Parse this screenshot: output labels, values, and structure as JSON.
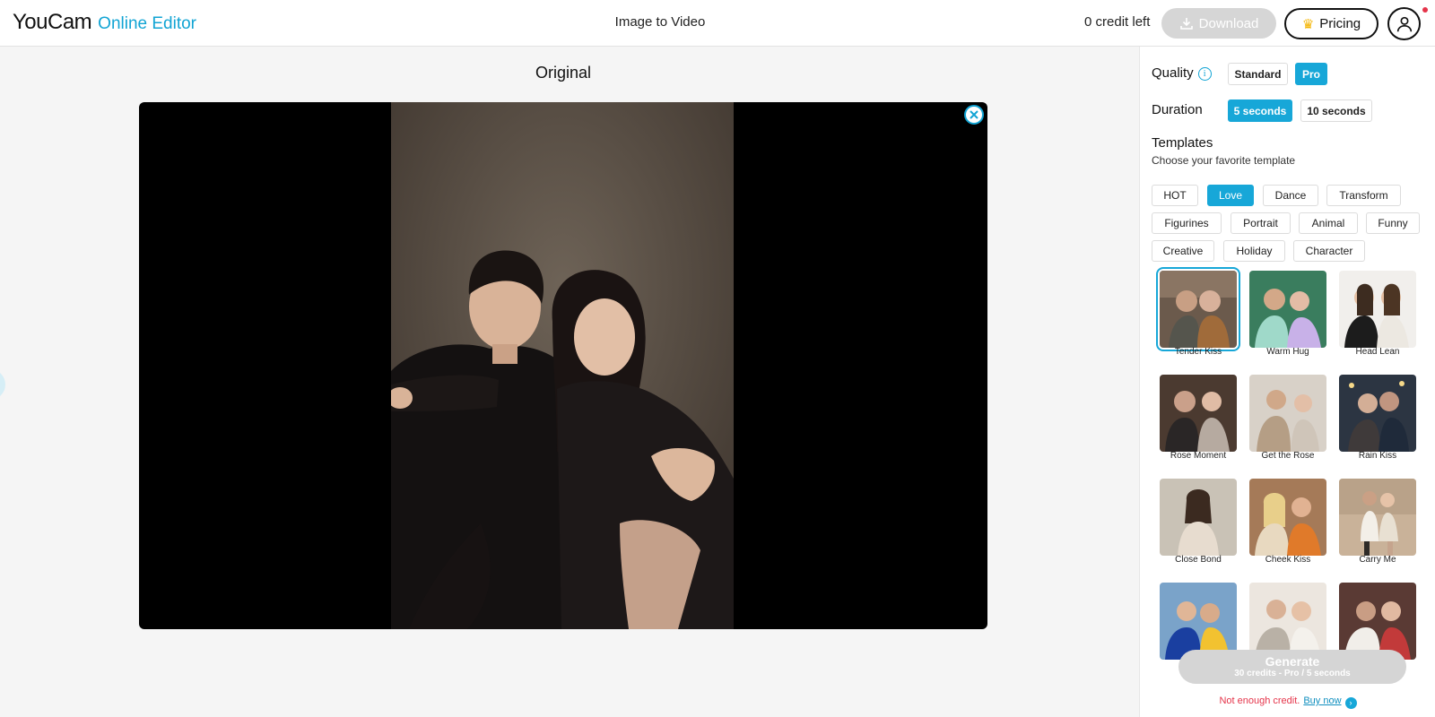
{
  "header": {
    "logo_main": "YouCam",
    "logo_sub": "Online Editor",
    "title": "Image to Video",
    "credits": "0 credit left",
    "download_label": "Download",
    "pricing_label": "Pricing"
  },
  "main": {
    "title": "Original"
  },
  "panel": {
    "quality": {
      "label": "Quality",
      "options": [
        "Standard",
        "Pro"
      ],
      "selected": "Pro"
    },
    "duration": {
      "label": "Duration",
      "options": [
        "5 seconds",
        "10 seconds"
      ],
      "selected": "5 seconds"
    },
    "templates": {
      "title": "Templates",
      "subtitle": "Choose your favorite template",
      "categories": [
        "HOT",
        "Love",
        "Dance",
        "Transform",
        "Figurines",
        "Portrait",
        "Animal",
        "Funny",
        "Creative",
        "Holiday",
        "Character"
      ],
      "selected_category": "Love",
      "items": [
        "Tender Kiss",
        "Warm Hug",
        "Head Lean",
        "Rose Moment",
        "Get the Rose",
        "Rain Kiss",
        "Close Bond",
        "Cheek Kiss",
        "Carry Me"
      ],
      "selected_item": "Tender Kiss"
    },
    "generate": {
      "label": "Generate",
      "sub": "30 credits - Pro / 5 seconds"
    },
    "warning": {
      "text": "Not enough credit.",
      "link": "Buy now"
    }
  },
  "colors": {
    "accent": "#17a7d8",
    "logo_accent": "#11a4d4",
    "warning": "#e5344a",
    "disabled": "#d5d5d5"
  }
}
